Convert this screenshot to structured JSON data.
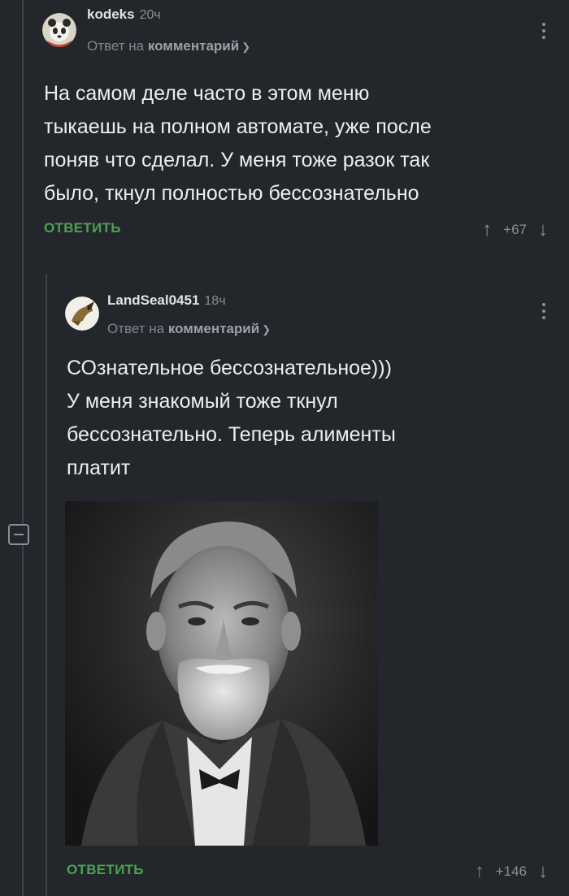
{
  "comments": [
    {
      "username": "kodeks",
      "time": "20ч",
      "reply_prefix": "Ответ на",
      "reply_target": "комментарий",
      "text": "На самом деле часто в этом меню\nтыкаешь на полном автомате, уже после\nпоняв что сделал. У меня тоже разок так\nбыло, ткнул полностью бессознательно",
      "reply_label": "ОТВЕТИТЬ",
      "rating": "+67"
    },
    {
      "username": "LandSeal0451",
      "time": "18ч",
      "reply_prefix": "Ответ на",
      "reply_target": "комментарий",
      "text": "СОзнательное бессознательное)))\nУ меня знакомый тоже ткнул\nбессознательно. Теперь алименты\nплатит",
      "reply_label": "ОТВЕТИТЬ",
      "rating": "+146"
    }
  ],
  "icons": {
    "up": "arrow-up-icon",
    "down": "arrow-down-icon",
    "menu": "more-vertical-icon",
    "collapse": "collapse-icon"
  },
  "colors": {
    "background": "#23272b",
    "accent_green": "#4aa350",
    "muted": "#8a9096"
  }
}
